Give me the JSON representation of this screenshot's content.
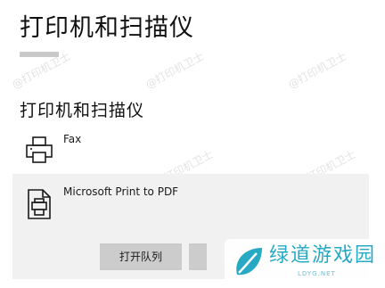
{
  "page_title": "打印机和扫描仪",
  "section_heading": "打印机和扫描仪",
  "printers": [
    {
      "name": "Fax",
      "icon": "fax-printer-icon"
    },
    {
      "name": "Microsoft Print to PDF",
      "icon": "pdf-printer-icon"
    }
  ],
  "selected_printer_actions": {
    "open_queue_label": "打开队列"
  },
  "watermark_text": "@打印机卫士",
  "brand": {
    "name": "绿道游戏园",
    "domain": "LDYG.NET"
  },
  "colors": {
    "selected_row_bg": "#f1f1f1",
    "button_bg": "#cccccc",
    "brand_accent": "#27a9c4"
  }
}
